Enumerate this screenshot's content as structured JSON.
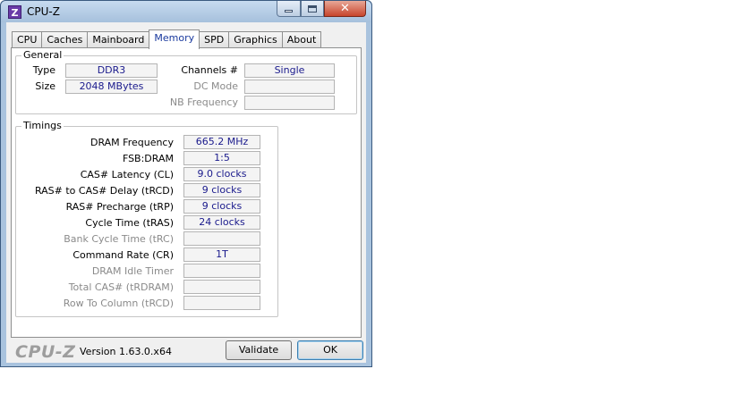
{
  "window": {
    "title": "CPU-Z",
    "icon_letter": "Z"
  },
  "tabs": [
    {
      "label": "CPU"
    },
    {
      "label": "Caches"
    },
    {
      "label": "Mainboard"
    },
    {
      "label": "Memory",
      "active": true
    },
    {
      "label": "SPD"
    },
    {
      "label": "Graphics"
    },
    {
      "label": "About"
    }
  ],
  "general": {
    "title": "General",
    "type_label": "Type",
    "type_value": "DDR3",
    "size_label": "Size",
    "size_value": "2048 MBytes",
    "channels_label": "Channels #",
    "channels_value": "Single",
    "dc_mode_label": "DC Mode",
    "dc_mode_value": "",
    "nb_freq_label": "NB Frequency",
    "nb_freq_value": ""
  },
  "timings": {
    "title": "Timings",
    "rows": [
      {
        "label": "DRAM Frequency",
        "value": "665.2 MHz",
        "enabled": true
      },
      {
        "label": "FSB:DRAM",
        "value": "1:5",
        "enabled": true
      },
      {
        "label": "CAS# Latency (CL)",
        "value": "9.0 clocks",
        "enabled": true
      },
      {
        "label": "RAS# to CAS# Delay (tRCD)",
        "value": "9 clocks",
        "enabled": true
      },
      {
        "label": "RAS# Precharge (tRP)",
        "value": "9 clocks",
        "enabled": true
      },
      {
        "label": "Cycle Time (tRAS)",
        "value": "24 clocks",
        "enabled": true
      },
      {
        "label": "Bank Cycle Time (tRC)",
        "value": "",
        "enabled": false
      },
      {
        "label": "Command Rate (CR)",
        "value": "1T",
        "enabled": true
      },
      {
        "label": "DRAM Idle Timer",
        "value": "",
        "enabled": false
      },
      {
        "label": "Total CAS# (tRDRAM)",
        "value": "",
        "enabled": false
      },
      {
        "label": "Row To Column (tRCD)",
        "value": "",
        "enabled": false
      }
    ]
  },
  "footer": {
    "logo": "CPU-Z",
    "version": "Version 1.63.0.x64",
    "validate_label": "Validate",
    "ok_label": "OK"
  }
}
